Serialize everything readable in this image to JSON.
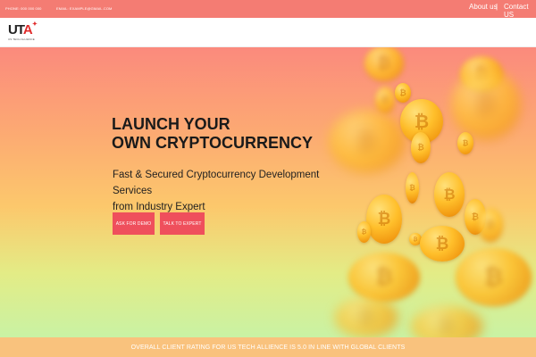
{
  "topbar": {
    "phone": "PHONE: 000 000 000",
    "email": "EMAIL: EXAMPLE@GMAIL.COM",
    "about": "About us",
    "separator": "|",
    "contact": "Contact US"
  },
  "logo": {
    "mark_main": "UT",
    "mark_accent": "A",
    "spark": "✦",
    "tagline": "US TECH ALLIENCE"
  },
  "hero": {
    "title_line1": "LAUNCH YOUR",
    "title_line2": "OWN CRYPTOCURRENCY",
    "subtitle_line1": "Fast & Secured Cryptocurrency Development Services",
    "subtitle_line2": "from Industry Expert",
    "primary_button": "ASK FOR DEMO",
    "secondary_button": "TALK TO EXPERT",
    "coin_symbol": "₿"
  },
  "rating_band": {
    "text": "OVERALL CLIENT RATING FOR US TECH ALLIENCE IS 5.0 IN LINE WITH GLOBAL CLIENTS"
  },
  "colors": {
    "topbar": "#f47c73",
    "button": "#ef4f5c",
    "rating_band": "#f9c27d",
    "coin": "#ffbf2b"
  }
}
